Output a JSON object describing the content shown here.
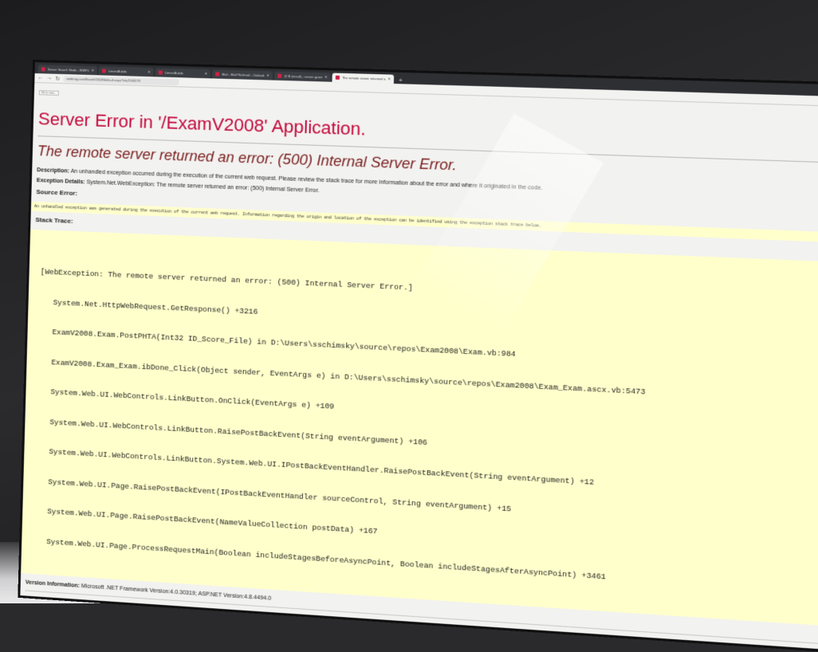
{
  "browser": {
    "tabs": [
      {
        "label": "Server Search Node - WWF1",
        "active": false
      },
      {
        "label": "LimeniBuilds",
        "active": false
      },
      {
        "label": "LimeniBuilds",
        "active": false
      },
      {
        "label": "Mail - Mail Richtseil - Outlook",
        "active": false
      },
      {
        "label": "@ B (result) - server grant",
        "active": false
      },
      {
        "label": "The remote server returned a",
        "active": true
      }
    ],
    "new_tab_glyph": "+",
    "url": "webtrng.com/ExamV2008/default.aspx?id=2566578",
    "hint": "Hit to view..."
  },
  "page": {
    "title": "Server Error in '/ExamV2008' Application.",
    "subtitle": "The remote server returned an error: (500) Internal Server Error.",
    "description_label": "Description:",
    "description_text": "An unhandled exception occurred during the execution of the current web request. Please review the stack trace for more information about the error and where it originated in the code.",
    "exception_label": "Exception Details:",
    "exception_text": "System.Net.WebException: The remote server returned an error: (500) Internal Server Error.",
    "source_error_label": "Source Error:",
    "source_error_text": "An unhandled exception was generated during the execution of the current web request. Information regarding the origin and location of the exception can be identified using the exception stack trace below.",
    "stack_trace_label": "Stack Trace:",
    "stack_lines": [
      "[WebException: The remote server returned an error: (500) Internal Server Error.]",
      "   System.Net.HttpWebRequest.GetResponse() +3216",
      "   ExamV2008.Exam.PostPHTA(Int32 ID_Score_File) in D:\\Users\\sschimsky\\source\\repos\\Exam2008\\Exam.vb:984",
      "   ExamV2008.Exam_Exam.ibDone_Click(Object sender, EventArgs e) in D:\\Users\\sschimsky\\source\\repos\\Exam2008\\Exam_Exam.ascx.vb:5473",
      "   System.Web.UI.WebControls.LinkButton.OnClick(EventArgs e) +109",
      "   System.Web.UI.WebControls.LinkButton.RaisePostBackEvent(String eventArgument) +106",
      "   System.Web.UI.WebControls.LinkButton.System.Web.UI.IPostBackEventHandler.RaisePostBackEvent(String eventArgument) +12",
      "   System.Web.UI.Page.RaisePostBackEvent(IPostBackEventHandler sourceControl, String eventArgument) +15",
      "   System.Web.UI.Page.RaisePostBackEvent(NameValueCollection postData) +167",
      "   System.Web.UI.Page.ProcessRequestMain(Boolean includeStagesBeforeAsyncPoint, Boolean includeStagesAfterAsyncPoint) +3461"
    ],
    "version_label": "Version Information:",
    "version_text": "Microsoft .NET Framework Version:4.0.30319; ASP.NET Version:4.8.4494.0"
  },
  "colors": {
    "title_red": "#c4083a",
    "subtitle": "#7a1e1e",
    "yellow_box": "#ffffcc"
  }
}
